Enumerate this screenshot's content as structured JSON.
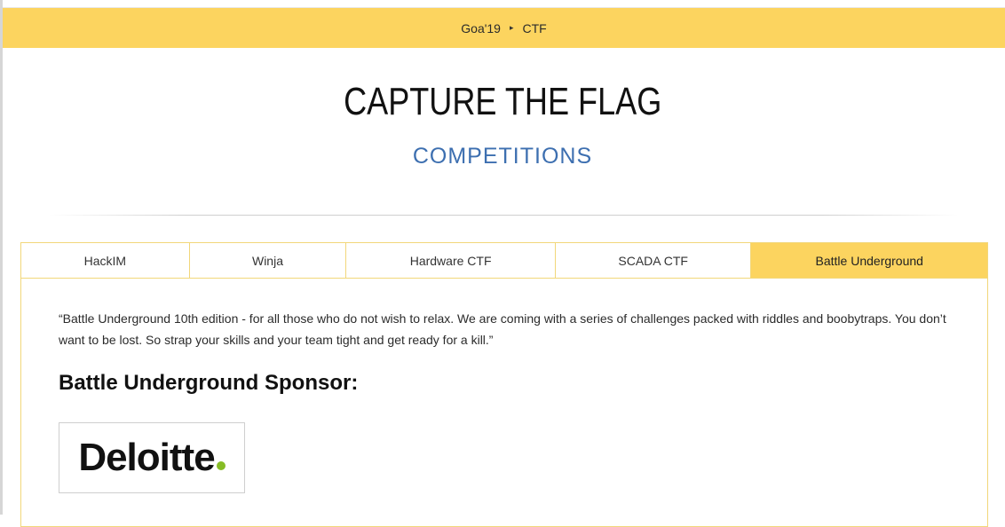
{
  "breadcrumb": {
    "items": [
      "Goa'19",
      "CTF"
    ],
    "separator": "▸"
  },
  "header": {
    "title": "CAPTURE THE FLAG",
    "subtitle": "COMPETITIONS"
  },
  "tabs": [
    {
      "label": "HackIM",
      "active": false
    },
    {
      "label": "Winja",
      "active": false
    },
    {
      "label": "Hardware CTF",
      "active": false
    },
    {
      "label": "SCADA CTF",
      "active": false
    },
    {
      "label": "Battle Underground",
      "active": true
    }
  ],
  "panel": {
    "description": "“Battle Underground 10th edition - for all those who do not wish to relax. We are coming with a series of challenges packed with riddles and boobytraps. You don’t want to be lost. So strap your skills and your team tight and get ready for a kill.”",
    "sponsor_heading": "Battle Underground Sponsor:",
    "sponsor_logo_text": "Deloitte"
  },
  "colors": {
    "accent_yellow": "#fcd45f",
    "subtitle_blue": "#3d6fb0",
    "deloitte_green": "#86bc25"
  }
}
